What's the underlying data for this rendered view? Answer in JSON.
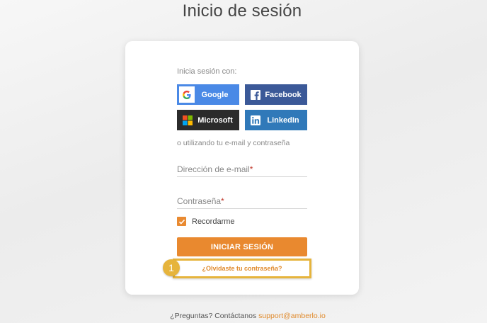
{
  "page": {
    "title": "Inicio de sesión"
  },
  "login": {
    "signin_with": "Inicia sesión con:",
    "providers": [
      {
        "label": "Google",
        "icon": "google-icon",
        "color": "#4a89e6"
      },
      {
        "label": "Facebook",
        "icon": "facebook-icon",
        "color": "#3b5998"
      },
      {
        "label": "Microsoft",
        "icon": "microsoft-icon",
        "color": "#2b2b2b"
      },
      {
        "label": "LinkedIn",
        "icon": "linkedin-icon",
        "color": "#3079b9"
      }
    ],
    "or_text": "o utilizando tu e-mail y contraseña",
    "email_label": "Dirección de e-mail",
    "password_label": "Contraseña",
    "required_mark": "*",
    "remember_label": "Recordarme",
    "remember_checked": true,
    "submit_label": "INICIAR SESIÓN",
    "forgot_label": "¿Olvidaste tu contraseña?"
  },
  "annotation": {
    "step": "1",
    "color": "#e6b43c"
  },
  "footer": {
    "question": "¿Preguntas? Contáctanos",
    "email": "support@amberlo.io"
  },
  "colors": {
    "accent": "#e9892f"
  }
}
